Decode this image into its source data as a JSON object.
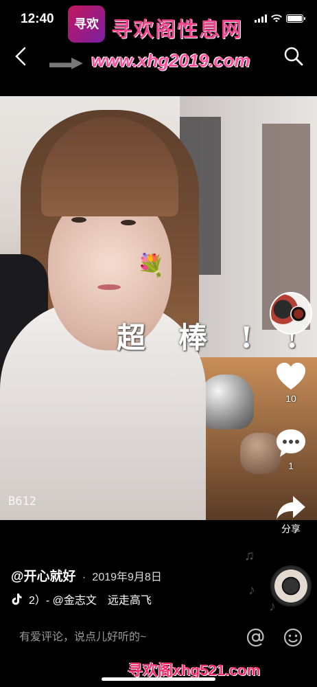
{
  "status_bar": {
    "time": "12:40"
  },
  "watermark": {
    "logo_text": "寻欢",
    "title": "寻欢阁性息网",
    "url": "www.xhg2019.com",
    "bottom": "寻欢阁xhg521.com"
  },
  "nav": {
    "back_icon": "chevron-left-icon",
    "search_icon": "search-icon"
  },
  "video": {
    "sticker_text": "超棒!!",
    "camera_mark": "B612"
  },
  "actions": {
    "like_count": "10",
    "comment_count": "1",
    "share_label": "分享"
  },
  "post": {
    "author": "@开心就好",
    "separator": "·",
    "date": "2019年9月8日",
    "music": "2）- @金志文　远走高飞"
  },
  "comment": {
    "placeholder": "有爱评论，说点儿好听的~"
  },
  "colors": {
    "accent": "#ff2a6d",
    "background": "#000000"
  }
}
